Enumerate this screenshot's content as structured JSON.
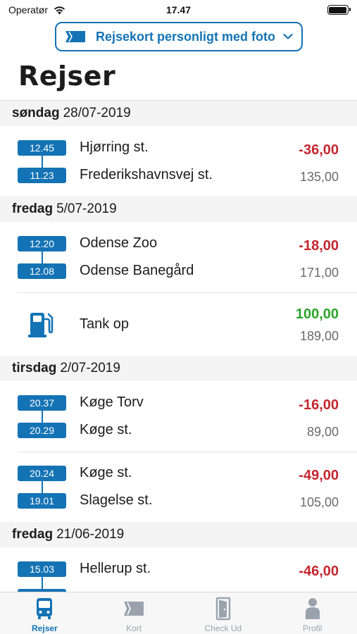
{
  "status_bar": {
    "carrier": "Operatør",
    "time": "17.47"
  },
  "card_selector": {
    "label": "Rejsekort personligt med foto"
  },
  "page": {
    "title": "Rejser"
  },
  "days": [
    {
      "weekday": "søndag",
      "date": "28/07-2019",
      "trips": [
        {
          "type": "trip",
          "time_top": "12.45",
          "station_top": "Hjørring st.",
          "time_bottom": "11.23",
          "station_bottom": "Frederikshavnsvej st.",
          "amount": "-36,00",
          "balance": "135,00"
        }
      ]
    },
    {
      "weekday": "fredag",
      "date": "5/07-2019",
      "trips": [
        {
          "type": "trip",
          "time_top": "12.20",
          "station_top": "Odense Zoo",
          "time_bottom": "12.08",
          "station_bottom": "Odense Banegård",
          "amount": "-18,00",
          "balance": "171,00"
        },
        {
          "type": "refuel",
          "label": "Tank op",
          "amount": "100,00",
          "balance": "189,00"
        }
      ]
    },
    {
      "weekday": "tirsdag",
      "date": "2/07-2019",
      "trips": [
        {
          "type": "trip",
          "time_top": "20.37",
          "station_top": "Køge Torv",
          "time_bottom": "20.29",
          "station_bottom": "Køge st.",
          "amount": "-16,00",
          "balance": "89,00"
        },
        {
          "type": "trip",
          "time_top": "20.24",
          "station_top": "Køge st.",
          "time_bottom": "19.01",
          "station_bottom": "Slagelse st.",
          "amount": "-49,00",
          "balance": "105,00"
        }
      ]
    },
    {
      "weekday": "fredag",
      "date": "21/06-2019",
      "trips": [
        {
          "type": "trip",
          "time_top": "15.03",
          "station_top": "Hellerup st.",
          "time_bottom": "",
          "station_bottom": "",
          "amount": "-46,00",
          "balance": ""
        }
      ]
    }
  ],
  "tabbar": {
    "tabs": [
      {
        "label": "Rejser",
        "icon": "bus-icon",
        "active": true
      },
      {
        "label": "Kort",
        "icon": "card-icon",
        "active": false
      },
      {
        "label": "Check Ud",
        "icon": "door-icon",
        "active": false
      },
      {
        "label": "Profil",
        "icon": "person-icon",
        "active": false
      }
    ]
  },
  "colors": {
    "accent": "#1473b5",
    "negative": "#c4262e",
    "positive": "#2aa52a",
    "section_background": "#f4f4f4"
  }
}
